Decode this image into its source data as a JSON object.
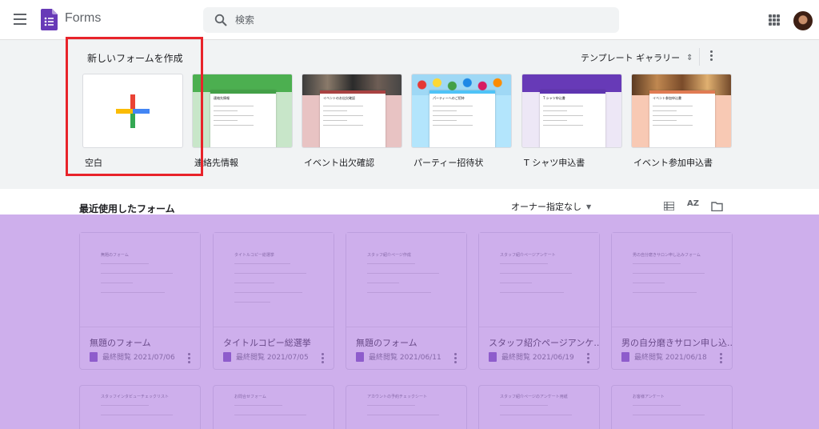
{
  "header": {
    "app_title": "Forms",
    "search_placeholder": "検索",
    "icons": {
      "menu": "hamburger-icon",
      "logo": "forms-logo-icon",
      "search": "search-icon",
      "apps": "apps-grid-icon",
      "account": "avatar"
    }
  },
  "templates": {
    "heading": "新しいフォームを作成",
    "gallery_label": "テンプレート ギャラリー",
    "items": [
      {
        "label": "空白"
      },
      {
        "label": "連絡先情報",
        "preview_title": "連絡先情報"
      },
      {
        "label": "イベント出欠確認",
        "preview_title": "イベントのお出欠確認"
      },
      {
        "label": "パーティー招待状",
        "preview_title": "パーティーへのご招待"
      },
      {
        "label": "T シャツ申込書",
        "preview_title": "T シャツ申込書"
      },
      {
        "label": "イベント参加申込書",
        "preview_title": "イベント参加申込書"
      }
    ],
    "colors": {
      "contact": "#4caf50",
      "rsvp": "#a84242",
      "party": "#4fc3f7",
      "tshirt": "#673ab7",
      "event": "#e07b53"
    }
  },
  "recent": {
    "heading": "最近使用したフォーム",
    "owner_filter": "オーナー指定なし",
    "sort_label": "AZ",
    "docs": [
      {
        "name": "無題のフォーム",
        "meta": "最終閲覧 2021/07/06",
        "preview_title": "無題のフォーム"
      },
      {
        "name": "タイトルコピー総選挙",
        "meta": "最終閲覧 2021/07/05",
        "preview_title": "タイトルコピー総選挙"
      },
      {
        "name": "無題のフォーム",
        "meta": "最終閲覧 2021/06/11",
        "preview_title": "スタッフ紹介ページ作成"
      },
      {
        "name": "スタッフ紹介ページアンケ...",
        "meta": "最終閲覧 2021/06/19",
        "preview_title": "スタッフ紹介ページアンケート"
      },
      {
        "name": "男の自分磨きサロン申し込...",
        "meta": "最終閲覧 2021/06/18",
        "preview_title": "男の自分磨きサロン申し込みフォーム"
      }
    ],
    "row2_titles": [
      "スタッフインタビューチェックリスト",
      "お問合せフォーム",
      "アカウントの予約チェックシート",
      "スタッフ紹介ページのアンケート用紙",
      "お客様アンケート"
    ]
  },
  "annotation": {
    "highlight_color": "#e8232a",
    "overlay_color": "#a56edc"
  }
}
